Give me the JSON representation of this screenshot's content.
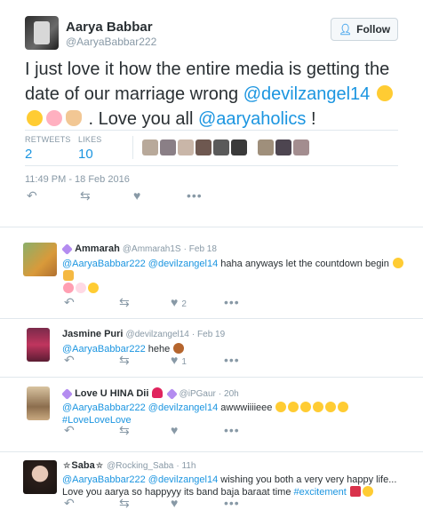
{
  "main_tweet": {
    "author_name": "Aarya Babbar",
    "author_handle": "@AaryaBabbar222",
    "follow_label": "Follow",
    "text_prefix": "I just love it how the entire media is getting the date of our marriage wrong ",
    "mention1": "@devilzangel14",
    "text_middle": " . Love you all ",
    "mention2": "@aaryaholics",
    "text_suffix": "  !",
    "retweets_label": "RETWEETS",
    "retweets_count": "2",
    "likes_label": "LIKES",
    "likes_count": "10",
    "timestamp": "11:49 PM - 18 Feb 2016",
    "icons": [
      "reply-icon",
      "retweet-icon",
      "like-icon",
      "more-icon"
    ]
  },
  "replies": [
    {
      "name": "Ammarah",
      "handle": "@Ammarah1S",
      "date": "· Feb 18",
      "mentions": "@AaryaBabbar222 @devilzangel14",
      "text": " haha anyways let the countdown begin ",
      "likes": "2"
    },
    {
      "name": "Jasmine Puri",
      "handle": "@devilzangel14",
      "date": "· Feb 19",
      "mentions": "@AaryaBabbar222",
      "text": " hehe ",
      "likes": "1"
    },
    {
      "name": "Love U HINA Dii",
      "handle": "@iPGaur",
      "date": "· 20h",
      "mentions": "@AaryaBabbar222 @devilzangel14",
      "text": " awwwiiiieee ",
      "hashtag": "#LoveLoveLove",
      "likes": ""
    },
    {
      "name": "Saba",
      "handle": "@Rocking_Saba",
      "date": "· 11h",
      "mentions": "@AaryaBabbar222 @devilzangel14",
      "text": " wishing you both a very very happy life...",
      "line2": "Love you aarya so happyyy its band baja baraat time ",
      "hashtag": "#excitement",
      "likes": ""
    }
  ],
  "colors": {
    "link": "#1b95e0",
    "muted": "#8899a6",
    "text": "#292f33",
    "border": "#e1e8ed"
  }
}
